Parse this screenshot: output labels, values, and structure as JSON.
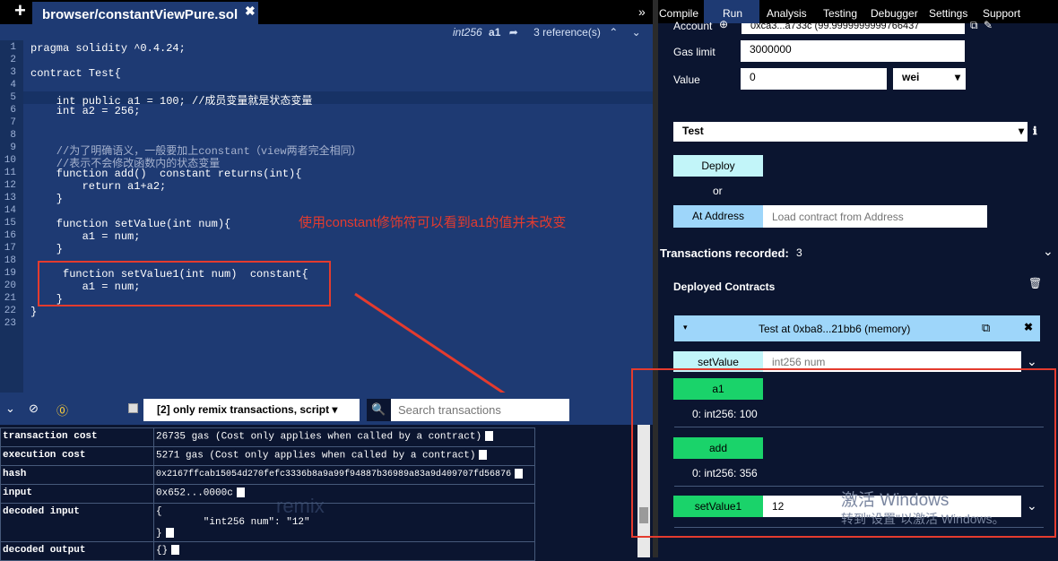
{
  "tabbar": {
    "plus": "+",
    "filename": "browser/constantViewPure.sol",
    "close": "✖"
  },
  "editor_header": {
    "type": "int256",
    "name": "a1",
    "refs": "3 reference(s)"
  },
  "code": [
    {
      "n": "1",
      "t": "pragma solidity ^0.4.24;"
    },
    {
      "n": "2",
      "t": ""
    },
    {
      "n": "3",
      "t": "contract Test{"
    },
    {
      "n": "4",
      "t": ""
    },
    {
      "n": "5",
      "t": "    int public a1 = 100; //成员变量就是状态变量"
    },
    {
      "n": "6",
      "t": "    int a2 = 256;"
    },
    {
      "n": "7",
      "t": ""
    },
    {
      "n": "8",
      "t": ""
    },
    {
      "n": "9",
      "t": "    //为了明确语义，一般要加上constant（view两者完全相同）"
    },
    {
      "n": "10",
      "t": "    //表示不会修改函数内的状态变量"
    },
    {
      "n": "11",
      "t": "    function add()  constant returns(int){"
    },
    {
      "n": "12",
      "t": "        return a1+a2;"
    },
    {
      "n": "13",
      "t": "    }"
    },
    {
      "n": "14",
      "t": ""
    },
    {
      "n": "15",
      "t": "    function setValue(int num){"
    },
    {
      "n": "16",
      "t": "        a1 = num;"
    },
    {
      "n": "17",
      "t": "    }"
    },
    {
      "n": "18",
      "t": ""
    },
    {
      "n": "19",
      "t": "     function setValue1(int num)  constant{"
    },
    {
      "n": "20",
      "t": "        a1 = num;"
    },
    {
      "n": "21",
      "t": "    }"
    },
    {
      "n": "22",
      "t": "}"
    },
    {
      "n": "23",
      "t": ""
    }
  ],
  "annotation": "使用constant修饰符可以看到a1的值并未改变",
  "terminal": {
    "filter": "[2] only remix transactions, script",
    "search_placeholder": "Search transactions",
    "rows": [
      {
        "k": "transaction cost",
        "v": "26735 gas (Cost only applies when called by a contract)"
      },
      {
        "k": "execution cost",
        "v": "5271 gas (Cost only applies when called by a contract)"
      },
      {
        "k": "hash",
        "v": "0x2167ffcab15054d270fefc3336b8a9a99f94887b36989a83a9d409707fd56876"
      },
      {
        "k": "input",
        "v": "0x652...0000c"
      },
      {
        "k": "decoded input",
        "v1": "{",
        "v2": "        \"int256 num\": \"12\"",
        "v3": "}"
      },
      {
        "k": "decoded output",
        "v": "{}"
      }
    ],
    "watermark": "remix"
  },
  "nav": {
    "items": [
      "Compile",
      "Run",
      "Analysis",
      "Testing",
      "Debugger",
      "Settings",
      "Support"
    ]
  },
  "run": {
    "account_label": "Account",
    "account_value": "0xca3...a733c (99.9999999999766437",
    "gas_label": "Gas limit",
    "gas_value": "3000000",
    "value_label": "Value",
    "value_value": "0",
    "unit": "wei",
    "contract": "Test",
    "deploy": "Deploy",
    "or": "or",
    "at_address": "At Address",
    "at_placeholder": "Load contract from Address",
    "tx_recorded": "Transactions recorded:",
    "tx_count": "3",
    "deployed": "Deployed Contracts",
    "instance": "Test at 0xba8...21bb6 (memory)",
    "setValue": "setValue",
    "setValue_ph": "int256 num",
    "a1": "a1",
    "a1_out": "0: int256: 100",
    "add": "add",
    "add_out": "0: int256: 356",
    "setValue1": "setValue1",
    "setValue1_val": "12"
  },
  "windows": {
    "line1": "激活 Windows",
    "line2": "转到\"设置\"以激活 Windows。"
  },
  "colors": {
    "accent": "#1e3a73",
    "red": "#e43b2e",
    "green": "#1ad36a",
    "cyan": "#c2f5f9"
  }
}
